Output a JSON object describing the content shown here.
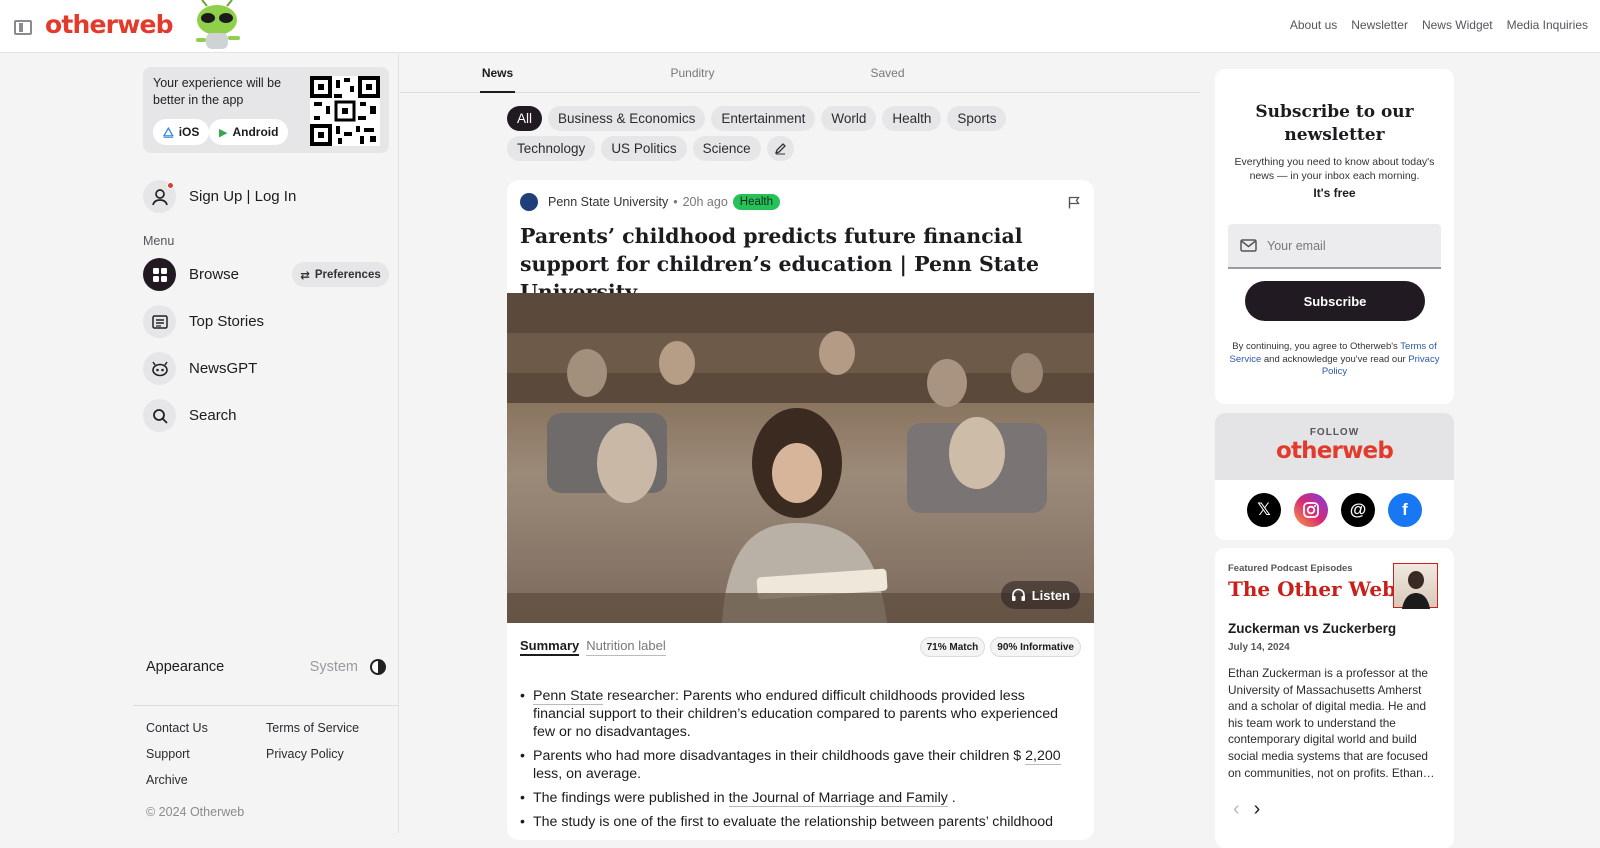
{
  "header": {
    "logo": "otherweb",
    "nav": [
      "About us",
      "Newsletter",
      "News Widget",
      "Media Inquiries"
    ]
  },
  "sidebar": {
    "promo_text": "Your experience will be better in the app",
    "ios_label": "iOS",
    "android_label": "Android",
    "auth_label": "Sign Up | Log In",
    "menu_label": "Menu",
    "items": [
      {
        "label": "Browse",
        "icon": "grid-icon"
      },
      {
        "label": "Top Stories",
        "icon": "newspaper-icon"
      },
      {
        "label": "NewsGPT",
        "icon": "robot-icon"
      },
      {
        "label": "Search",
        "icon": "search-icon"
      }
    ],
    "preferences_label": "Preferences",
    "appearance_label": "Appearance",
    "appearance_value": "System",
    "footer_links": [
      "Contact Us",
      "Terms of Service",
      "Support",
      "Privacy Policy",
      "Archive"
    ],
    "copyright": "© 2024 Otherweb"
  },
  "main": {
    "tabs": [
      "News",
      "Punditry",
      "Saved"
    ],
    "active_tab": "News",
    "categories": [
      "All",
      "Business & Economics",
      "Entertainment",
      "World",
      "Health",
      "Sports",
      "Technology",
      "US Politics",
      "Science"
    ],
    "active_category": "All",
    "article": {
      "source": "Penn State University",
      "time": "20h ago",
      "badge": "Health",
      "headline": "Parents’ childhood predicts future financial support for children’s education | Penn State University",
      "listen_label": "Listen",
      "summary_tab": "Summary",
      "nutrition_tab": "Nutrition label",
      "match": "71% Match",
      "informative": "90% Informative",
      "bullets": {
        "b1_link": "Penn State",
        "b1_text": " researcher: Parents who endured difficult childhoods provided less financial support to their children’s education compared to parents who experienced few or no disadvantages.",
        "b2_pre": "Parents who had more disadvantages in their childhoods gave their children $ ",
        "b2_link": "2,200",
        "b2_post": " less, on average.",
        "b3_pre": "The findings were published in ",
        "b3_link": "the Journal of Marriage and Family",
        "b3_post": " .",
        "b4_text": "The study is one of the first to evaluate the relationship between parents’ childhood"
      }
    }
  },
  "right": {
    "newsletter": {
      "title": "Subscribe to our newsletter",
      "subtitle": "Everything you need to know about today's news — in your inbox each morning.",
      "free": "It's free",
      "email_placeholder": "Your email",
      "subscribe_label": "Subscribe",
      "legal_pre": "By continuing, you agree to Otherweb's ",
      "legal_terms": "Terms of Service",
      "legal_mid": " and acknowledge you've read our ",
      "legal_privacy": "Privacy Policy"
    },
    "follow": {
      "label": "FOLLOW",
      "logo": "otherweb"
    },
    "podcast": {
      "label": "Featured Podcast Episodes",
      "title": "The Other Web",
      "episode_title": "Zuckerman vs Zuckerberg",
      "date": "July 14, 2024",
      "body": "Ethan Zuckerman is a professor at the University of Massachusetts Amherst and a scholar of digital media. He and his team work to understand the contemporary digital world and build social media systems that are focused on communities, not on profits. Ethan…"
    }
  },
  "colors": {
    "brand": "#e23b2c",
    "dark": "#221a22",
    "health_badge": "#27c15a",
    "link": "#2a5aa8"
  }
}
